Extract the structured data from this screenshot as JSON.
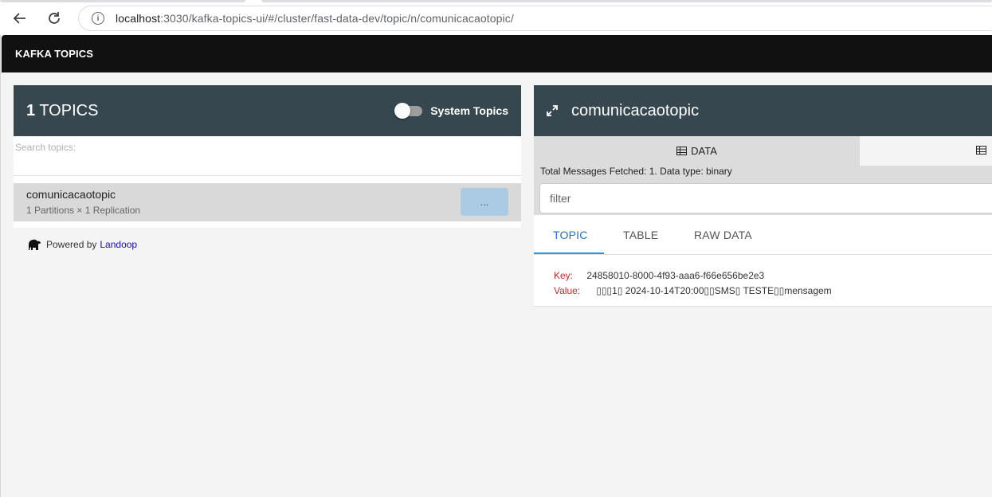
{
  "browser": {
    "url_host": "localhost",
    "url_path": ":3030/kafka-topics-ui/#/cluster/fast-data-dev/topic/n/comunicacaotopic/"
  },
  "app": {
    "title": "KAFKA TOPICS"
  },
  "topics_panel": {
    "count": "1",
    "count_label": "TOPICS",
    "system_topics_label": "System Topics",
    "system_topics_enabled": false,
    "search_placeholder": "Search topics:",
    "topics": [
      {
        "name": "comunicacaotopic",
        "meta": "1 Partitions × 1 Replication",
        "button_label": "..."
      }
    ],
    "powered_by": "Powered by",
    "powered_link": "Landoop"
  },
  "detail_panel": {
    "topic_name": "comunicacaotopic",
    "data_tab_label": "DATA",
    "fetch_info": "Total Messages Fetched: 1. Data type: binary",
    "filter_placeholder": "filter",
    "sub_tabs": [
      "TOPIC",
      "TABLE",
      "RAW DATA"
    ],
    "active_sub_tab": "TOPIC",
    "message": {
      "key_label": "Key:",
      "key_value": "24858010-8000-4f93-aaa6-f66e656be2e3",
      "value_label": "Value:",
      "value_value": "▯▯▯1▯ 2024-10-14T20:00▯▯SMS▯ TESTE▯▯mensagem"
    }
  },
  "colors": {
    "header_bg": "#111111",
    "panel_header_bg": "#37474f",
    "accent_blue": "#2196f3",
    "label_red": "#c62828",
    "button_blue": "#abcbe5"
  }
}
